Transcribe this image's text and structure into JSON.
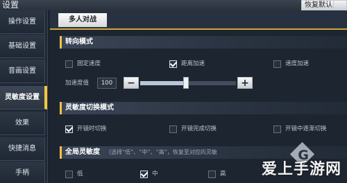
{
  "header": {
    "title": "设置",
    "restore_label": "恢复默认",
    "extra_label": ""
  },
  "sidebar": {
    "items": [
      {
        "label": "操作设置",
        "active": false
      },
      {
        "label": "基础设置",
        "active": false
      },
      {
        "label": "音画设置",
        "active": false
      },
      {
        "label": "灵敏度设置",
        "active": true
      },
      {
        "label": "效果",
        "active": false
      },
      {
        "label": "快捷消息",
        "active": false
      },
      {
        "label": "手柄",
        "active": false
      }
    ]
  },
  "tabs": [
    {
      "label": "多人对战",
      "selected": true
    }
  ],
  "steer_mode": {
    "title": "转向模式",
    "options": [
      {
        "label": "固定速度",
        "checked": false
      },
      {
        "label": "距离加速",
        "checked": true
      },
      {
        "label": "速度加速",
        "checked": false
      }
    ],
    "accel": {
      "label": "加速度值",
      "value": "100",
      "level_fraction": 0.48
    }
  },
  "sensitivity_switch": {
    "title": "灵敏度切换模式",
    "options": [
      {
        "label": "开镜时切换",
        "checked": true
      },
      {
        "label": "开镜完成切换",
        "checked": false
      },
      {
        "label": "开镜中逐渐切换",
        "checked": false
      }
    ]
  },
  "global_sensitivity": {
    "title": "全局灵敏度",
    "hint": "（选择“低”、“中”、“高”，恢复至对应的灵敏",
    "options": [
      {
        "label": "低",
        "checked": false
      },
      {
        "label": "中",
        "checked": true
      },
      {
        "label": "高",
        "checked": false
      }
    ]
  },
  "watermark": {
    "text": "爱上手游网",
    "badge_letter": "G"
  },
  "colors": {
    "accent": "#f3c73c",
    "background": "#1d2531",
    "sidebar": "#1f2835"
  }
}
